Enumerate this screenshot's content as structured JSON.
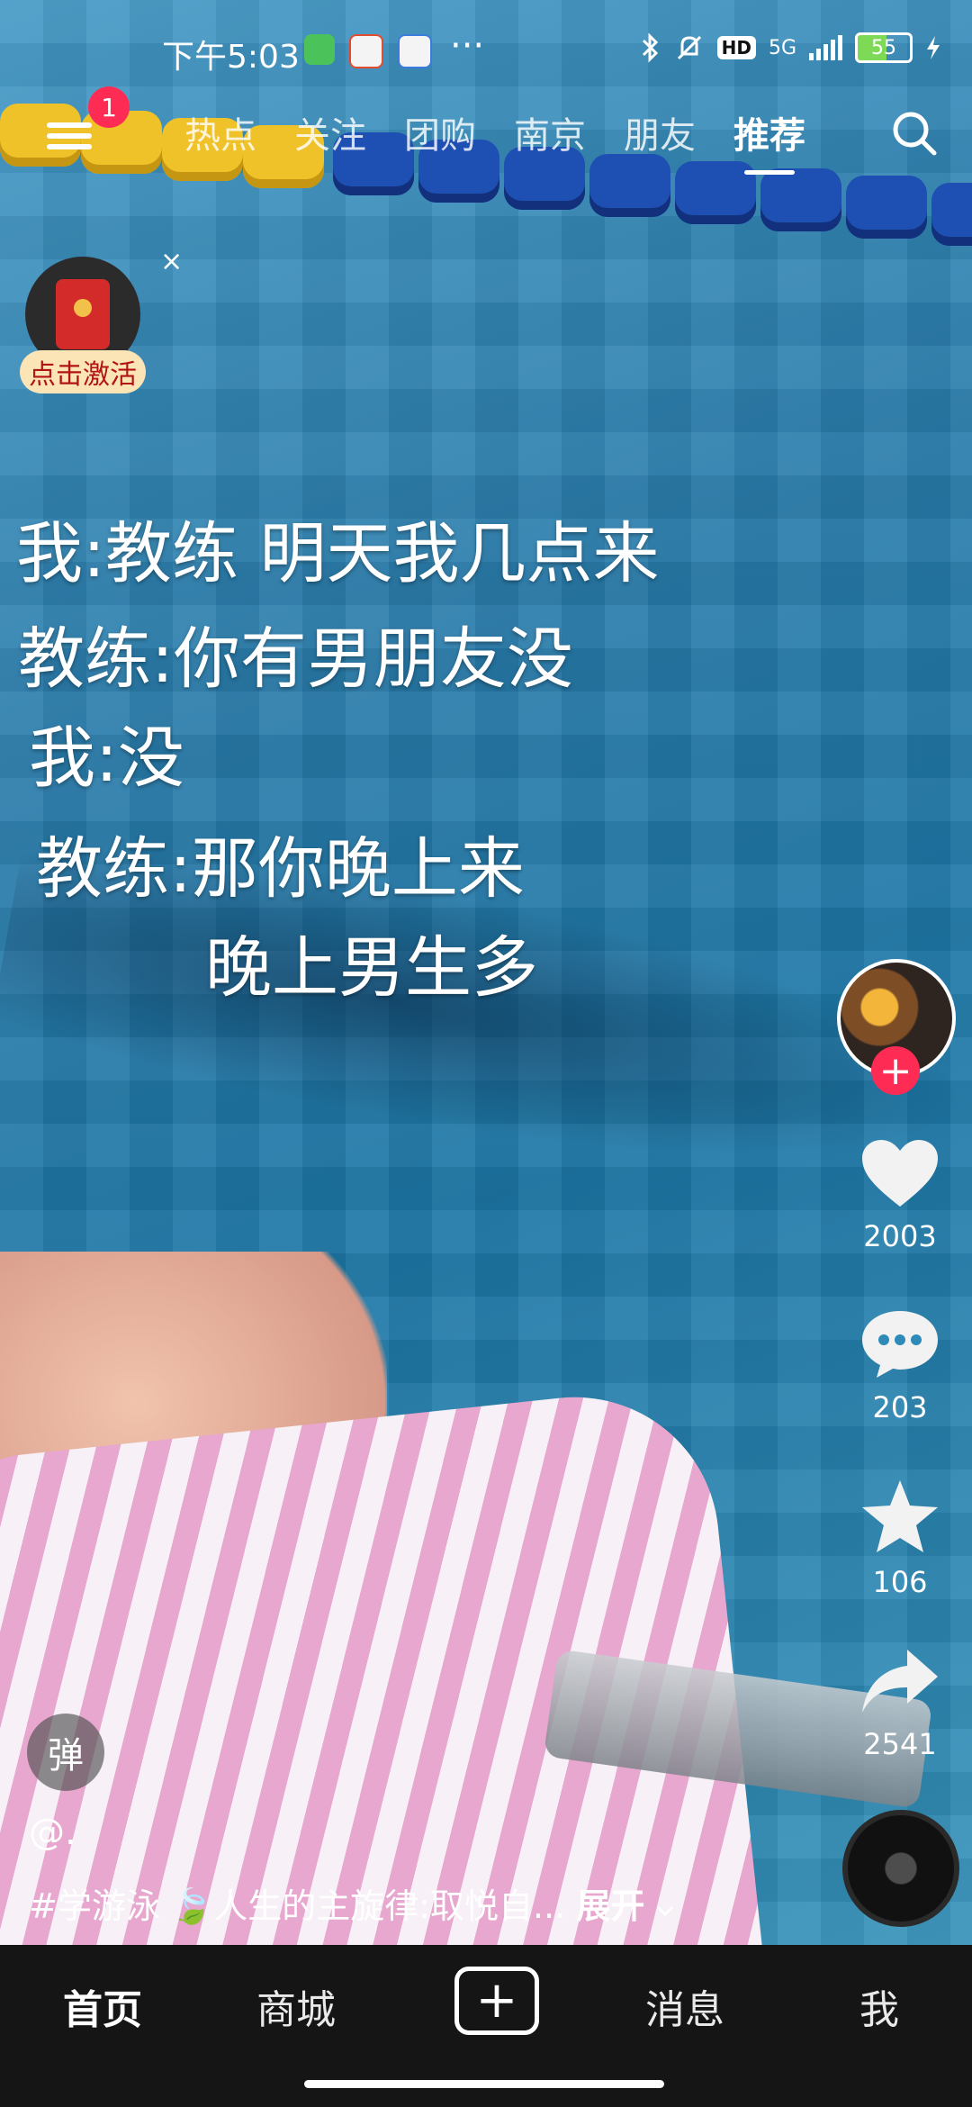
{
  "status_bar": {
    "time": "下午5:03",
    "more": "···",
    "network": "5G",
    "hd": "HD",
    "battery": "55",
    "icons": [
      "app-icon-green",
      "app-icon-58",
      "app-icon-baidu",
      "bluetooth-icon",
      "mute-icon",
      "signal-icon",
      "charging-icon"
    ]
  },
  "top_nav": {
    "badge": "1",
    "tabs": [
      "热点",
      "关注",
      "团购",
      "南京",
      "朋友",
      "推荐"
    ],
    "active_tab": "推荐"
  },
  "red_packet": {
    "label": "点击激活",
    "close": "×"
  },
  "caption": {
    "line1": "我:教练 明天我几点来",
    "line2": "教练:你有男朋友没",
    "line3": "我:没",
    "line4": "教练:那你晚上来",
    "line5": "晚上男生多"
  },
  "actions": {
    "follow": "+",
    "likes": "2003",
    "comments": "203",
    "favorites": "106",
    "shares": "2541"
  },
  "bottom_info": {
    "danmu": "弹",
    "username": "@.",
    "description": "#学游泳 🍃人生的主旋律:取悦自...",
    "expand": "展开"
  },
  "bottom_nav": {
    "home": "首页",
    "mall": "商城",
    "create": "+",
    "messages": "消息",
    "me": "我"
  },
  "colors": {
    "accent": "#fe2c55",
    "nav_bg": "#151515",
    "packet_label_bg": "#fbe5b7"
  }
}
